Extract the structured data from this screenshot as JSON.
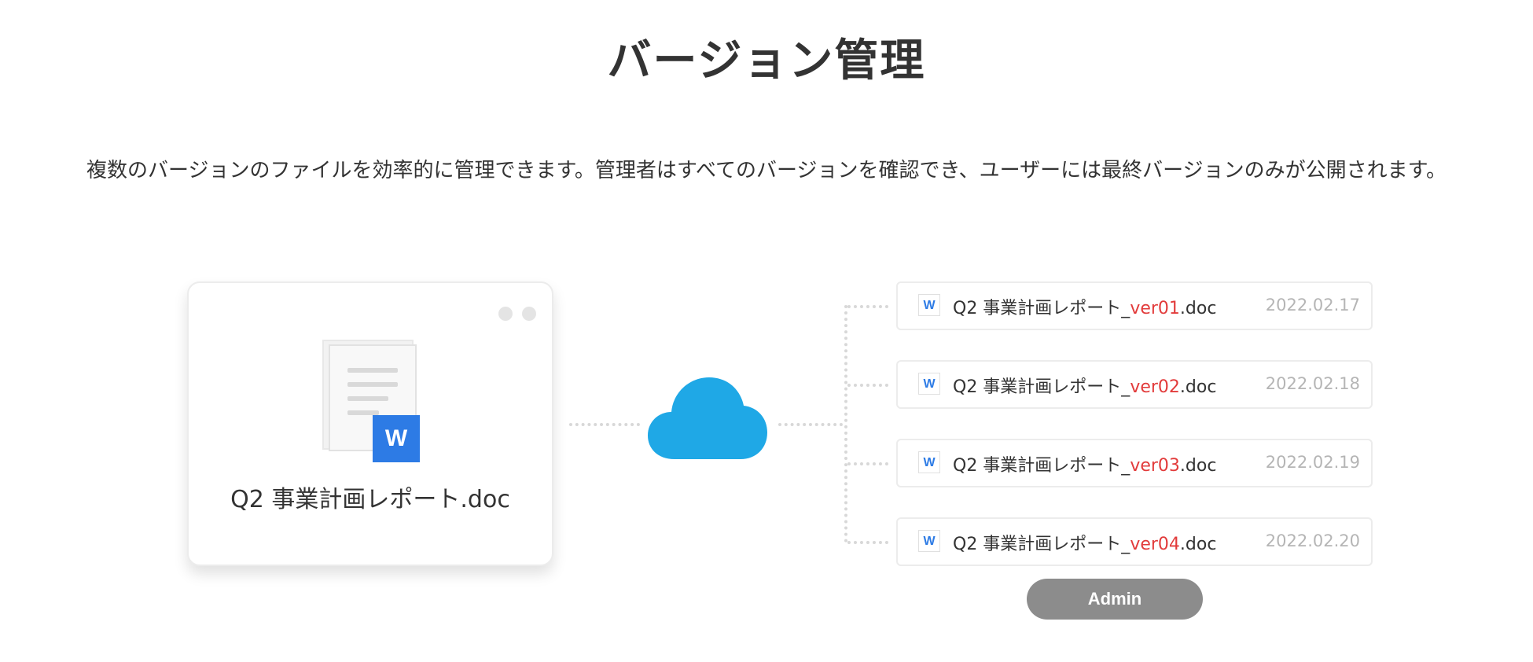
{
  "header": {
    "title": "バージョン管理",
    "description": "複数のバージョンのファイルを効率的に管理できます。管理者はすべてのバージョンを確認でき、ユーザーには最終バージョンのみが公開されます。"
  },
  "source_file": {
    "name": "Q2 事業計画レポート.doc",
    "badge": "W"
  },
  "versions": [
    {
      "prefix": "Q2 事業計画レポート_",
      "ver": "ver01",
      "suffix": ".doc",
      "date": "2022.02.17",
      "icon": "W"
    },
    {
      "prefix": "Q2 事業計画レポート_",
      "ver": "ver02",
      "suffix": ".doc",
      "date": "2022.02.18",
      "icon": "W"
    },
    {
      "prefix": "Q2 事業計画レポート_",
      "ver": "ver03",
      "suffix": ".doc",
      "date": "2022.02.19",
      "icon": "W"
    },
    {
      "prefix": "Q2 事業計画レポート_",
      "ver": "ver04",
      "suffix": ".doc",
      "date": "2022.02.20",
      "icon": "W"
    }
  ],
  "admin_button": {
    "label": "Admin"
  },
  "colors": {
    "word_blue": "#2d7be5",
    "cloud_blue": "#1fa8e6",
    "version_highlight": "#e23b3b",
    "admin_gray": "#8c8c8c"
  },
  "icons": {
    "document": "word-document-icon",
    "cloud": "cloud-icon"
  }
}
